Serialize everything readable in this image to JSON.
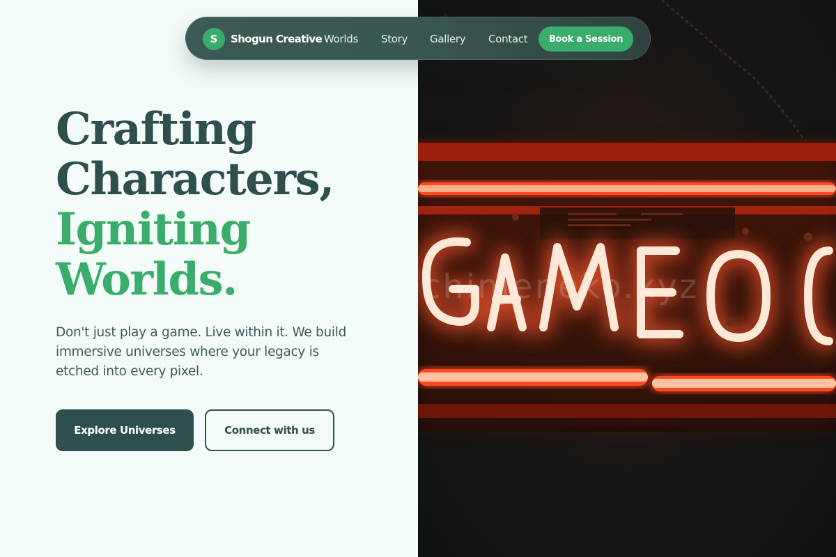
{
  "nav": {
    "logo_letter": "S",
    "brand": "Shogun Creative",
    "links": [
      "Worlds",
      "Story",
      "Gallery",
      "Contact"
    ],
    "cta": "Book a Session"
  },
  "hero": {
    "headline_dark": [
      "Crafting",
      "Characters,"
    ],
    "headline_green": [
      "Igniting",
      "Worlds."
    ],
    "lead": "Don't just play a game. Live within it. We build immersive universes where your legacy is etched into every pixel.",
    "primary_button": "Explore Universes",
    "secondary_button": "Connect with us"
  },
  "image": {
    "sign_text": "GAMEO",
    "watermark": "chinjeneko.xyz"
  },
  "colors": {
    "dark": "#2f4f4f",
    "accent": "#3aac6c",
    "background": "#f3fcf8",
    "neon": "#ff5a2e"
  }
}
